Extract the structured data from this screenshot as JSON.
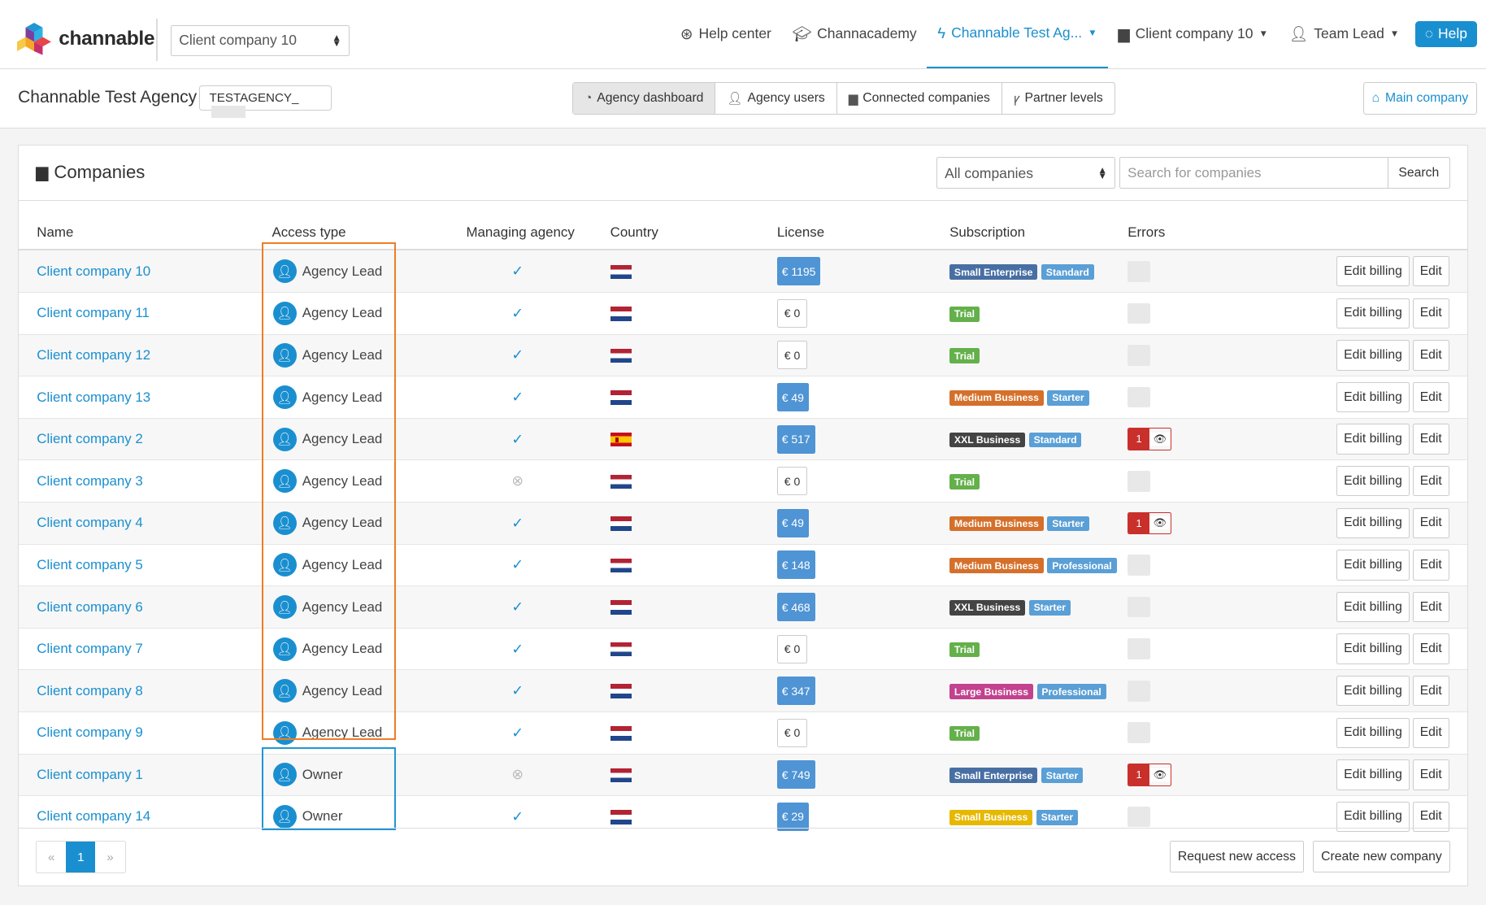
{
  "header": {
    "brand": "channable",
    "company_select": "Client company 10",
    "nav": {
      "help_center": "Help center",
      "channacademy": "Channacademy",
      "agency": "Channable Test Ag...",
      "company": "Client company 10",
      "user": "Team Lead",
      "help": "Help"
    }
  },
  "subbar": {
    "agency_name": "Channable Test Agency",
    "agency_code": "TESTAGENCY_",
    "tabs": [
      "Agency dashboard",
      "Agency users",
      "Connected companies",
      "Partner levels"
    ],
    "main_company": "Main company"
  },
  "panel": {
    "title": "Companies",
    "filter": "All companies",
    "search_placeholder": "Search for companies",
    "search_button": "Search",
    "columns": [
      "Name",
      "Access type",
      "Managing agency",
      "Country",
      "License",
      "Subscription",
      "Errors"
    ],
    "edit_billing": "Edit billing",
    "edit": "Edit",
    "rows": [
      {
        "name": "Client company 10",
        "access": "Agency Lead",
        "managed": true,
        "flag": "nl",
        "license": "€ 1195",
        "paid": true,
        "badges": [
          {
            "t": "Small Enterprise",
            "c": "b-se"
          },
          {
            "t": "Standard",
            "c": "b-std"
          }
        ],
        "errors": "0"
      },
      {
        "name": "Client company 11",
        "access": "Agency Lead",
        "managed": true,
        "flag": "nl",
        "license": "€ 0",
        "paid": false,
        "badges": [
          {
            "t": "Trial",
            "c": "b-trial"
          }
        ],
        "errors": "0"
      },
      {
        "name": "Client company 12",
        "access": "Agency Lead",
        "managed": true,
        "flag": "nl",
        "license": "€ 0",
        "paid": false,
        "badges": [
          {
            "t": "Trial",
            "c": "b-trial"
          }
        ],
        "errors": "0"
      },
      {
        "name": "Client company 13",
        "access": "Agency Lead",
        "managed": true,
        "flag": "nl",
        "license": "€ 49",
        "paid": true,
        "badges": [
          {
            "t": "Medium Business",
            "c": "b-mb"
          },
          {
            "t": "Starter",
            "c": "b-std"
          }
        ],
        "errors": "0"
      },
      {
        "name": "Client company 2",
        "access": "Agency Lead",
        "managed": true,
        "flag": "es",
        "license": "€ 517",
        "paid": true,
        "badges": [
          {
            "t": "XXL Business",
            "c": "b-xxl"
          },
          {
            "t": "Standard",
            "c": "b-std"
          }
        ],
        "errors": "1"
      },
      {
        "name": "Client company 3",
        "access": "Agency Lead",
        "managed": false,
        "flag": "nl",
        "license": "€ 0",
        "paid": false,
        "badges": [
          {
            "t": "Trial",
            "c": "b-trial"
          }
        ],
        "errors": "0"
      },
      {
        "name": "Client company 4",
        "access": "Agency Lead",
        "managed": true,
        "flag": "nl",
        "license": "€ 49",
        "paid": true,
        "badges": [
          {
            "t": "Medium Business",
            "c": "b-mb"
          },
          {
            "t": "Starter",
            "c": "b-std"
          }
        ],
        "errors": "1"
      },
      {
        "name": "Client company 5",
        "access": "Agency Lead",
        "managed": true,
        "flag": "nl",
        "license": "€ 148",
        "paid": true,
        "badges": [
          {
            "t": "Medium Business",
            "c": "b-mb"
          },
          {
            "t": "Professional",
            "c": "b-std"
          }
        ],
        "errors": "0"
      },
      {
        "name": "Client company 6",
        "access": "Agency Lead",
        "managed": true,
        "flag": "nl",
        "license": "€ 468",
        "paid": true,
        "badges": [
          {
            "t": "XXL Business",
            "c": "b-xxl"
          },
          {
            "t": "Starter",
            "c": "b-std"
          }
        ],
        "errors": "0"
      },
      {
        "name": "Client company 7",
        "access": "Agency Lead",
        "managed": true,
        "flag": "nl",
        "license": "€ 0",
        "paid": false,
        "badges": [
          {
            "t": "Trial",
            "c": "b-trial"
          }
        ],
        "errors": "0"
      },
      {
        "name": "Client company 8",
        "access": "Agency Lead",
        "managed": true,
        "flag": "nl",
        "license": "€ 347",
        "paid": true,
        "badges": [
          {
            "t": "Large Business",
            "c": "b-lb"
          },
          {
            "t": "Professional",
            "c": "b-std"
          }
        ],
        "errors": "0"
      },
      {
        "name": "Client company 9",
        "access": "Agency Lead",
        "managed": true,
        "flag": "nl",
        "license": "€ 0",
        "paid": false,
        "badges": [
          {
            "t": "Trial",
            "c": "b-trial"
          }
        ],
        "errors": "0"
      },
      {
        "name": "Client company 1",
        "access": "Owner",
        "managed": false,
        "flag": "nl",
        "license": "€ 749",
        "paid": true,
        "badges": [
          {
            "t": "Small Enterprise",
            "c": "b-se"
          },
          {
            "t": "Starter",
            "c": "b-std"
          }
        ],
        "errors": "1"
      },
      {
        "name": "Client company 14",
        "access": "Owner",
        "managed": true,
        "flag": "nl",
        "license": "€ 29",
        "paid": true,
        "badges": [
          {
            "t": "Small Business",
            "c": "b-sb"
          },
          {
            "t": "Starter",
            "c": "b-std"
          }
        ],
        "errors": "0"
      }
    ]
  },
  "footer": {
    "prev": "«",
    "page": "1",
    "next": "»",
    "request_access": "Request new access",
    "create_company": "Create new company"
  },
  "colors": {
    "accent": "#1a8fd0",
    "highlight_agency": "#ee7d23",
    "highlight_owner": "#1f97d4"
  }
}
